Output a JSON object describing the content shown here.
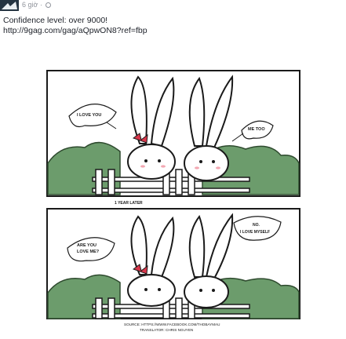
{
  "post": {
    "time": "6 giờ",
    "privacy_icon": "globe-icon",
    "text_line1": "Confidence level: over 9000!",
    "link": "http://9gag.com/gag/aQpwON8?ref=fbp"
  },
  "comic": {
    "panel1": {
      "left_bubble": "I LOVE YOU",
      "right_bubble": "ME TOO"
    },
    "caption": "1 YEAR LATER",
    "panel2": {
      "left_bubble_line1": "ARE YOU",
      "left_bubble_line2": "LOVE ME?",
      "right_bubble_line1": "NO.",
      "right_bubble_line2": "I LOVE MYSELF"
    },
    "source": "SOURCE: HTTPS://WWW.FACEBOOK.COM/THOBAYMAU",
    "translator": "TRANSLATOR: CHRIS NGUYEN"
  }
}
